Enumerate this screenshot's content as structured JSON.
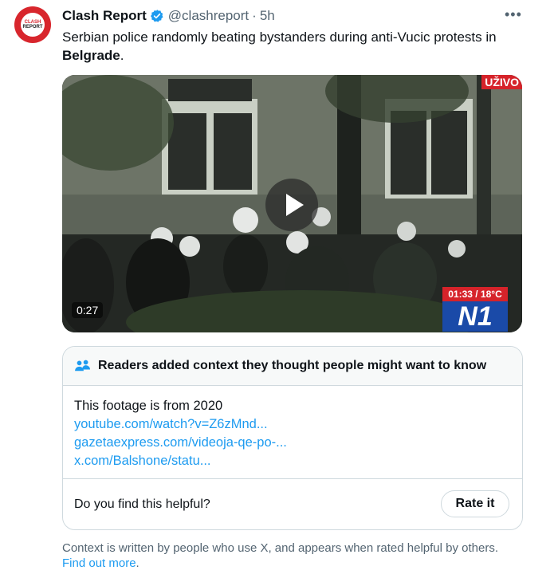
{
  "author": {
    "name": "Clash Report",
    "handle": "@clashreport",
    "separator": "·",
    "time": "5h",
    "avatar_text_1": "CLASH",
    "avatar_text_2": "REPORT",
    "verified_color": "#1d9bf0"
  },
  "tweet": {
    "text_plain": "Serbian police randomly beating bystanders during anti-Vucic protests in ",
    "text_bold": "Belgrade",
    "text_end": "."
  },
  "video": {
    "duration": "0:27",
    "live_label": "UŽIVO",
    "overlay_time": "01:33 / 18°C",
    "channel_logo": "N1"
  },
  "community_note": {
    "title": "Readers added context they thought people might want to know",
    "body_text": "This footage is from 2020",
    "links": [
      "youtube.com/watch?v=Z6zMnd...",
      "gazetaexpress.com/videoja-qe-po-...",
      "x.com/Balshone/statu..."
    ],
    "helpful_question": "Do you find this helpful?",
    "rate_button": "Rate it"
  },
  "footer": {
    "text": "Context is written by people who use X, and appears when rated helpful by others.",
    "link": "Find out more",
    "end": "."
  },
  "icons": {
    "more": "more-icon",
    "verified": "verified-badge-icon",
    "people": "people-icon",
    "play": "play-icon"
  }
}
